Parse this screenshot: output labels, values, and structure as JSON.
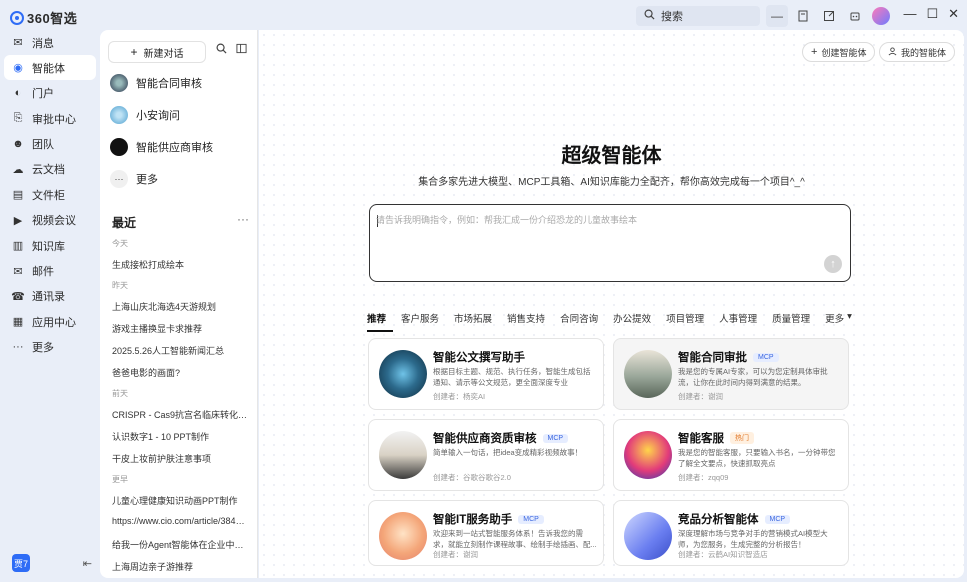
{
  "app": {
    "logo_text": "360智选",
    "search_label": "搜索"
  },
  "leftnav": {
    "items": [
      {
        "label": "消息",
        "icon": "message-icon"
      },
      {
        "label": "智能体",
        "icon": "agent-icon"
      },
      {
        "label": "门户",
        "icon": "portal-icon"
      },
      {
        "label": "审批中心",
        "icon": "approval-icon"
      },
      {
        "label": "团队",
        "icon": "team-icon"
      },
      {
        "label": "云文档",
        "icon": "cloud-doc-icon"
      },
      {
        "label": "文件柜",
        "icon": "file-cabinet-icon"
      },
      {
        "label": "视频会议",
        "icon": "video-meeting-icon"
      },
      {
        "label": "知识库",
        "icon": "knowledge-base-icon"
      },
      {
        "label": "邮件",
        "icon": "mail-icon"
      },
      {
        "label": "通讯录",
        "icon": "contacts-icon"
      },
      {
        "label": "应用中心",
        "icon": "app-center-icon"
      },
      {
        "label": "更多",
        "icon": "more-icon"
      }
    ],
    "user_initial": "贾7"
  },
  "panel2": {
    "new_chat_label": "新建对话",
    "agents": [
      {
        "label": "智能合同审核"
      },
      {
        "label": "小安询问"
      },
      {
        "label": "智能供应商审核"
      },
      {
        "label": "更多"
      }
    ],
    "recent_title": "最近",
    "history": [
      {
        "group": true,
        "text": "今天"
      },
      {
        "group": false,
        "text": "生成接松打成绘本"
      },
      {
        "group": true,
        "text": "昨天"
      },
      {
        "group": false,
        "text": "上海山庆北海选4天游规划"
      },
      {
        "group": false,
        "text": "游戏主播换显卡求推荐"
      },
      {
        "group": false,
        "text": "2025.5.26人工智能新闻汇总"
      },
      {
        "group": false,
        "text": "爸爸电影的画面?"
      },
      {
        "group": true,
        "text": "前天"
      },
      {
        "group": false,
        "text": "CRISPR - Cas9抗宫名临床转化伦..."
      },
      {
        "group": false,
        "text": "认识数字1 - 10 PPT制作"
      },
      {
        "group": false,
        "text": "干皮上妆前护肤注意事项"
      },
      {
        "group": true,
        "text": "更早"
      },
      {
        "group": false,
        "text": "儿童心理健康知识动画PPT制作"
      },
      {
        "group": false,
        "text": "https://www.cio.com/article/38433..."
      },
      {
        "group": false,
        "text": "给我一份Agent智能体在企业中典..."
      },
      {
        "group": false,
        "text": "上海周边亲子游推荐"
      }
    ]
  },
  "main": {
    "create_agent_label": "创建智能体",
    "my_agents_label": "我的智能体",
    "title": "超级智能体",
    "subtitle": "集合多家先进大模型、MCP工具箱、AI知识库能力全配齐，帮你高效完成每一个项目^_^",
    "prompt_placeholder": "请告诉我明确指令，例如：帮我汇成一份介绍恐龙的儿童故事绘本",
    "tabs": [
      "推荐",
      "客户服务",
      "市场拓展",
      "销售支持",
      "合同咨询",
      "办公提效",
      "项目管理",
      "人事管理",
      "质量管理",
      "更多"
    ],
    "cards": [
      {
        "title": "智能公文撰写助手",
        "tag": "",
        "desc": "根据目标主题、规范、执行任务，智能生成包括通知、请示等公文规范，更全面深度专业",
        "creator": "创建者：杨奕AI"
      },
      {
        "title": "智能合同审批",
        "tag": "MCP",
        "desc": "我是您的专属AI专家，可以为您定制具体审批流，让你在此时间内得到满意的结果。",
        "creator": "创建者：谢润"
      },
      {
        "title": "智能供应商资质审核",
        "tag": "MCP",
        "desc": "简单输入一句话，把idea变成精彩视频故事！",
        "creator": "创建者：谷歌谷歌谷2.0"
      },
      {
        "title": "智能客服",
        "tag": "热门",
        "desc": "我是您的智能客服，只要输入书名，一分钟带您了解全文要点，快速抓取亮点",
        "creator": "创建者：zqq09"
      },
      {
        "title": "智能IT服务助手",
        "tag": "MCP",
        "desc": "欢迎来到一站式智能服务体系！告诉我您的需求，就能立刻制作课程故事、绘制手绘插画、配...",
        "creator": "创建者：谢润"
      },
      {
        "title": "竞品分析智能体",
        "tag": "MCP",
        "desc": "深度理解市场与竞争对手的营销模式AI模型大师，为您服务，生成完整的分析报告！",
        "creator": "创建者：云鹤AI知识智造店"
      }
    ]
  },
  "colors": {
    "accent": "#2e6cf6",
    "background": "#e9eef8"
  }
}
